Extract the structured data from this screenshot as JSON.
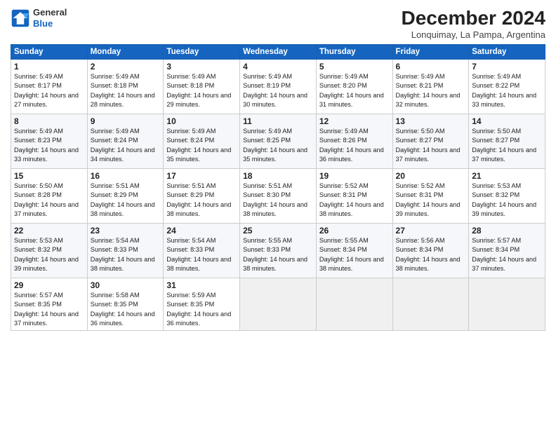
{
  "header": {
    "logo_line1": "General",
    "logo_line2": "Blue",
    "month_title": "December 2024",
    "location": "Lonquimay, La Pampa, Argentina"
  },
  "days_of_week": [
    "Sunday",
    "Monday",
    "Tuesday",
    "Wednesday",
    "Thursday",
    "Friday",
    "Saturday"
  ],
  "weeks": [
    [
      {
        "day": "1",
        "sunrise": "5:49 AM",
        "sunset": "8:17 PM",
        "daylight": "14 hours and 27 minutes."
      },
      {
        "day": "2",
        "sunrise": "5:49 AM",
        "sunset": "8:18 PM",
        "daylight": "14 hours and 28 minutes."
      },
      {
        "day": "3",
        "sunrise": "5:49 AM",
        "sunset": "8:18 PM",
        "daylight": "14 hours and 29 minutes."
      },
      {
        "day": "4",
        "sunrise": "5:49 AM",
        "sunset": "8:19 PM",
        "daylight": "14 hours and 30 minutes."
      },
      {
        "day": "5",
        "sunrise": "5:49 AM",
        "sunset": "8:20 PM",
        "daylight": "14 hours and 31 minutes."
      },
      {
        "day": "6",
        "sunrise": "5:49 AM",
        "sunset": "8:21 PM",
        "daylight": "14 hours and 32 minutes."
      },
      {
        "day": "7",
        "sunrise": "5:49 AM",
        "sunset": "8:22 PM",
        "daylight": "14 hours and 33 minutes."
      }
    ],
    [
      {
        "day": "8",
        "sunrise": "5:49 AM",
        "sunset": "8:23 PM",
        "daylight": "14 hours and 33 minutes."
      },
      {
        "day": "9",
        "sunrise": "5:49 AM",
        "sunset": "8:24 PM",
        "daylight": "14 hours and 34 minutes."
      },
      {
        "day": "10",
        "sunrise": "5:49 AM",
        "sunset": "8:24 PM",
        "daylight": "14 hours and 35 minutes."
      },
      {
        "day": "11",
        "sunrise": "5:49 AM",
        "sunset": "8:25 PM",
        "daylight": "14 hours and 35 minutes."
      },
      {
        "day": "12",
        "sunrise": "5:49 AM",
        "sunset": "8:26 PM",
        "daylight": "14 hours and 36 minutes."
      },
      {
        "day": "13",
        "sunrise": "5:50 AM",
        "sunset": "8:27 PM",
        "daylight": "14 hours and 37 minutes."
      },
      {
        "day": "14",
        "sunrise": "5:50 AM",
        "sunset": "8:27 PM",
        "daylight": "14 hours and 37 minutes."
      }
    ],
    [
      {
        "day": "15",
        "sunrise": "5:50 AM",
        "sunset": "8:28 PM",
        "daylight": "14 hours and 37 minutes."
      },
      {
        "day": "16",
        "sunrise": "5:51 AM",
        "sunset": "8:29 PM",
        "daylight": "14 hours and 38 minutes."
      },
      {
        "day": "17",
        "sunrise": "5:51 AM",
        "sunset": "8:29 PM",
        "daylight": "14 hours and 38 minutes."
      },
      {
        "day": "18",
        "sunrise": "5:51 AM",
        "sunset": "8:30 PM",
        "daylight": "14 hours and 38 minutes."
      },
      {
        "day": "19",
        "sunrise": "5:52 AM",
        "sunset": "8:31 PM",
        "daylight": "14 hours and 38 minutes."
      },
      {
        "day": "20",
        "sunrise": "5:52 AM",
        "sunset": "8:31 PM",
        "daylight": "14 hours and 39 minutes."
      },
      {
        "day": "21",
        "sunrise": "5:53 AM",
        "sunset": "8:32 PM",
        "daylight": "14 hours and 39 minutes."
      }
    ],
    [
      {
        "day": "22",
        "sunrise": "5:53 AM",
        "sunset": "8:32 PM",
        "daylight": "14 hours and 39 minutes."
      },
      {
        "day": "23",
        "sunrise": "5:54 AM",
        "sunset": "8:33 PM",
        "daylight": "14 hours and 38 minutes."
      },
      {
        "day": "24",
        "sunrise": "5:54 AM",
        "sunset": "8:33 PM",
        "daylight": "14 hours and 38 minutes."
      },
      {
        "day": "25",
        "sunrise": "5:55 AM",
        "sunset": "8:33 PM",
        "daylight": "14 hours and 38 minutes."
      },
      {
        "day": "26",
        "sunrise": "5:55 AM",
        "sunset": "8:34 PM",
        "daylight": "14 hours and 38 minutes."
      },
      {
        "day": "27",
        "sunrise": "5:56 AM",
        "sunset": "8:34 PM",
        "daylight": "14 hours and 38 minutes."
      },
      {
        "day": "28",
        "sunrise": "5:57 AM",
        "sunset": "8:34 PM",
        "daylight": "14 hours and 37 minutes."
      }
    ],
    [
      {
        "day": "29",
        "sunrise": "5:57 AM",
        "sunset": "8:35 PM",
        "daylight": "14 hours and 37 minutes."
      },
      {
        "day": "30",
        "sunrise": "5:58 AM",
        "sunset": "8:35 PM",
        "daylight": "14 hours and 36 minutes."
      },
      {
        "day": "31",
        "sunrise": "5:59 AM",
        "sunset": "8:35 PM",
        "daylight": "14 hours and 36 minutes."
      },
      null,
      null,
      null,
      null
    ]
  ]
}
